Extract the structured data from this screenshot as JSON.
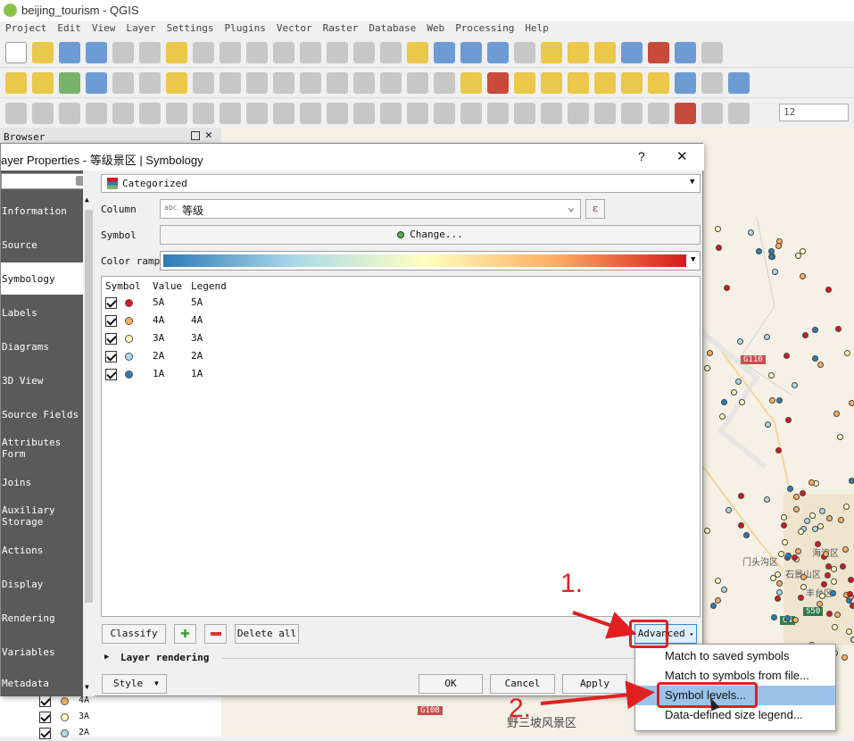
{
  "app": {
    "title": "beijing_tourism - QGIS"
  },
  "menubar": [
    "Project",
    "Edit",
    "View",
    "Layer",
    "Settings",
    "Plugins",
    "Vector",
    "Raster",
    "Database",
    "Web",
    "Processing",
    "Help"
  ],
  "toolbar": {
    "zoom_value": "12"
  },
  "browser": {
    "title": "Browser"
  },
  "dialog": {
    "title": "ayer Properties - 等级景区 | Symbology",
    "help": "?",
    "close": "✕",
    "renderer": "Categorized",
    "column_label": "Column",
    "column_type": "abc",
    "column_value": "等级",
    "symbol_label": "Symbol",
    "symbol_button": "Change...",
    "ramp_label": "Color ramp",
    "headers": {
      "symbol": "Symbol",
      "value": "Value",
      "legend": "Legend"
    },
    "categories": [
      {
        "value": "5A",
        "legend": "5A",
        "color": "#d7191c"
      },
      {
        "value": "4A",
        "legend": "4A",
        "color": "#fdae61"
      },
      {
        "value": "3A",
        "legend": "3A",
        "color": "#ffffbf"
      },
      {
        "value": "2A",
        "legend": "2A",
        "color": "#abd9e9"
      },
      {
        "value": "1A",
        "legend": "1A",
        "color": "#2c7bb6"
      }
    ],
    "classify": "Classify",
    "delete_all": "Delete all",
    "advanced": "Advanced",
    "layer_rendering": "Layer rendering",
    "style": "Style",
    "ok": "OK",
    "cancel": "Cancel",
    "apply": "Apply"
  },
  "sidebar": [
    "Information",
    "Source",
    "Symbology",
    "Labels",
    "Diagrams",
    "3D View",
    "Source Fields",
    "Attributes Form",
    "Joins",
    "Auxiliary Storage",
    "Actions",
    "Display",
    "Rendering",
    "Variables",
    "Metadata"
  ],
  "advanced_menu": [
    "Match to saved symbols",
    "Match to symbols from file...",
    "Symbol levels...",
    "Data-defined size legend..."
  ],
  "annotations": {
    "step1": "1.",
    "step2": "2."
  },
  "layer_panel": [
    "4A",
    "3A",
    "2A"
  ],
  "map_labels": {
    "road": "G110",
    "road2": "G108",
    "road3": "G4",
    "road4": "S50",
    "area1": "门头沟区",
    "area2": "石景山区",
    "area3": "丰台区",
    "area4": "海淀区",
    "area5": "野三坡风景区"
  }
}
